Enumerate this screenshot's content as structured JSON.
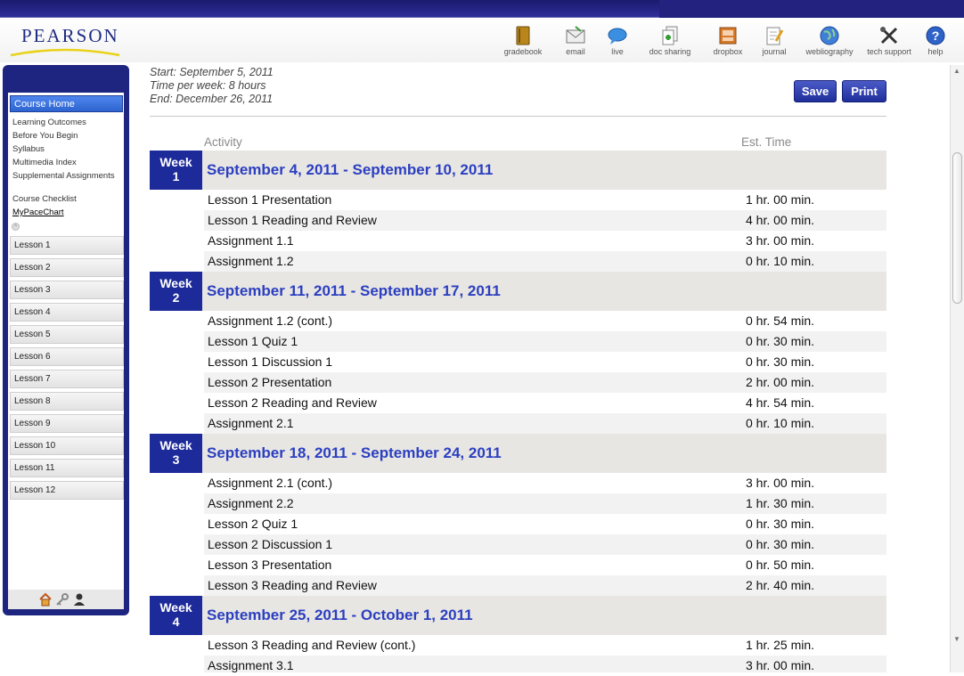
{
  "header": {
    "logo": "PEARSON",
    "tools": [
      {
        "label": "gradebook",
        "icon": "gradebook-icon"
      },
      {
        "label": "email",
        "icon": "email-icon"
      },
      {
        "label": "live",
        "icon": "live-chat-icon"
      },
      {
        "label": "doc sharing",
        "icon": "doc-sharing-icon"
      },
      {
        "label": "dropbox",
        "icon": "dropbox-icon"
      },
      {
        "label": "journal",
        "icon": "journal-icon"
      },
      {
        "label": "webliography",
        "icon": "globe-icon"
      },
      {
        "label": "tech support",
        "icon": "tools-icon"
      },
      {
        "label": "help",
        "icon": "help-icon"
      }
    ]
  },
  "sidebar": {
    "course_home": "Course Home",
    "links": [
      "Learning Outcomes",
      "Before You Begin",
      "Syllabus",
      "Multimedia Index",
      "Supplemental Assignments",
      "Course Checklist",
      "MyPaceChart"
    ],
    "lessons": [
      "Lesson 1",
      "Lesson 2",
      "Lesson 3",
      "Lesson 4",
      "Lesson 5",
      "Lesson 6",
      "Lesson 7",
      "Lesson 8",
      "Lesson 9",
      "Lesson 10",
      "Lesson 11",
      "Lesson 12"
    ]
  },
  "schedule": {
    "start": "Start: September 5, 2011",
    "time_per_week": "Time per week: 8 hours",
    "end": "End: December 26, 2011",
    "save_label": "Save",
    "print_label": "Print",
    "col_activity": "Activity",
    "col_time": "Est. Time",
    "weeks": [
      {
        "badge_word": "Week",
        "badge_num": "1",
        "title": "September 4, 2011 - September 10, 2011",
        "rows": [
          {
            "activity": "Lesson 1 Presentation",
            "time": "1 hr. 00 min."
          },
          {
            "activity": "Lesson 1 Reading and Review",
            "time": "4 hr. 00 min."
          },
          {
            "activity": "Assignment 1.1",
            "time": "3 hr. 00 min."
          },
          {
            "activity": "Assignment 1.2",
            "time": "0 hr. 10 min."
          }
        ]
      },
      {
        "badge_word": "Week",
        "badge_num": "2",
        "title": "September 11, 2011 - September 17, 2011",
        "rows": [
          {
            "activity": "Assignment 1.2 (cont.)",
            "time": "0 hr. 54 min."
          },
          {
            "activity": "Lesson 1 Quiz 1",
            "time": "0 hr. 30 min."
          },
          {
            "activity": "Lesson 1 Discussion 1",
            "time": "0 hr. 30 min."
          },
          {
            "activity": "Lesson 2 Presentation",
            "time": "2 hr. 00 min."
          },
          {
            "activity": "Lesson 2 Reading and Review",
            "time": "4 hr. 54 min."
          },
          {
            "activity": "Assignment 2.1",
            "time": "0 hr. 10 min."
          }
        ]
      },
      {
        "badge_word": "Week",
        "badge_num": "3",
        "title": "September 18, 2011 - September 24, 2011",
        "rows": [
          {
            "activity": "Assignment 2.1 (cont.)",
            "time": "3 hr. 00 min."
          },
          {
            "activity": "Assignment 2.2",
            "time": "1 hr. 30 min."
          },
          {
            "activity": "Lesson 2 Quiz 1",
            "time": "0 hr. 30 min."
          },
          {
            "activity": "Lesson 2 Discussion 1",
            "time": "0 hr. 30 min."
          },
          {
            "activity": "Lesson 3 Presentation",
            "time": "0 hr. 50 min."
          },
          {
            "activity": "Lesson 3 Reading and Review",
            "time": "2 hr. 40 min."
          }
        ]
      },
      {
        "badge_word": "Week",
        "badge_num": "4",
        "title": "September 25, 2011 - October 1, 2011",
        "rows": [
          {
            "activity": "Lesson 3 Reading and Review (cont.)",
            "time": "1 hr. 25 min."
          },
          {
            "activity": "Assignment 3.1",
            "time": "3 hr. 00 min."
          }
        ]
      }
    ]
  },
  "colors": {
    "brand_navy": "#1d2580",
    "week_badge": "#1d2a9a",
    "week_title": "#2b3fc0",
    "course_home_blue": "#3a72e0"
  }
}
